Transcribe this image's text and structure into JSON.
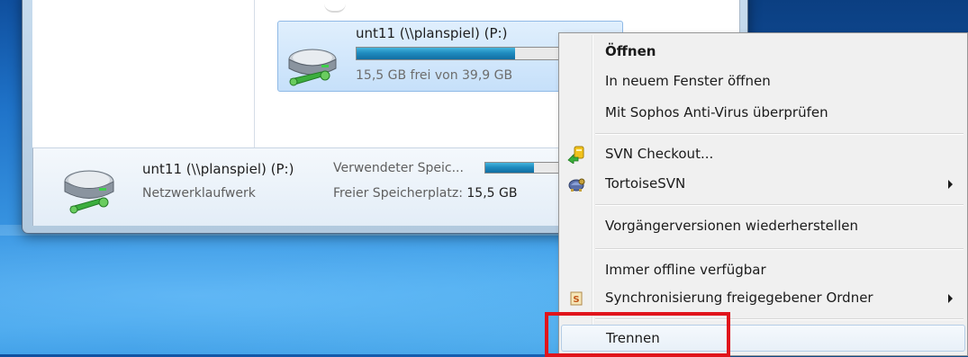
{
  "explorer": {
    "tile": {
      "name": "unt11 (\\\\planspiel) (P:)",
      "free_text": "15,5 GB frei von 39,9 GB",
      "used_fraction": 0.61,
      "icon": "network-drive-icon"
    },
    "details": {
      "name": "unt11 (\\\\planspiel) (P:)",
      "type": "Netzwerklaufwerk",
      "used_label": "Verwendeter Speic...",
      "used_fraction": 0.61,
      "free_label": "Freier Speicherplatz:",
      "free_value": "15,5 GB",
      "icon": "network-drive-icon"
    }
  },
  "context_menu": {
    "items": [
      {
        "label": "Öffnen",
        "bold": true
      },
      {
        "label": "In neuem Fenster öffnen"
      },
      {
        "label": "Mit Sophos Anti-Virus überprüfen"
      },
      {
        "label": "SVN Checkout...",
        "icon": "svn-checkout-icon"
      },
      {
        "label": "TortoiseSVN",
        "icon": "tortoise-svn-icon",
        "submenu": true
      },
      {
        "label": "Vorgängerversionen wiederherstellen"
      },
      {
        "label": "Immer offline verfügbar"
      },
      {
        "label": "Synchronisierung freigegebener Ordner",
        "icon": "sync-folder-icon",
        "submenu": true
      },
      {
        "label": "Trennen",
        "hovered": true
      }
    ]
  },
  "colors": {
    "highlight": "#e0141b",
    "progress": "#1f8cc0",
    "menu_bg": "#f0f0f0"
  }
}
